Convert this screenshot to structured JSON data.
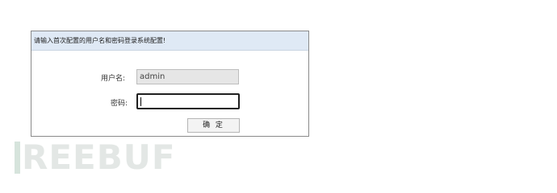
{
  "panel": {
    "header_text": "请输入首次配置的用户名和密码登录系统配置!"
  },
  "form": {
    "username_label": "用户名:",
    "username_value": "admin",
    "password_label": "密码:",
    "password_value": "",
    "confirm_label": "确 定"
  },
  "watermark": {
    "text": "REEBUF"
  }
}
